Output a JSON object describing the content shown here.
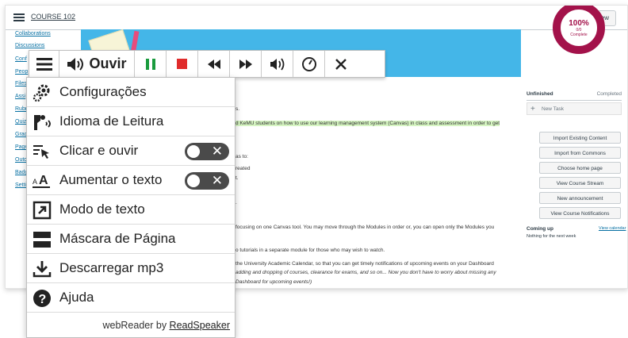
{
  "canvas": {
    "course_title": "COURSE 102",
    "student_view_label": "Student view",
    "nav_items": [
      "Collaborations",
      "Discussions",
      "Conf",
      "Peop",
      "Files",
      "Assi",
      "Rubr",
      "Quiz",
      "Grad",
      "Page",
      "Outc",
      "Badg",
      "Setti"
    ],
    "main_lines": [
      "s.",
      "d KeMU students on how to use our learning management system (Canvas) in class and assessment in order to get",
      "as to:",
      "reated",
      "t.",
      ".",
      "focusing on one Canvas tool. You may move through the Modules in order or, you can open only the Modules you",
      "o tutorials in a separate module for those who may wish to watch.",
      "the University Academic Calendar, so that you can get timely notifications of upcoming events on your Dashboard",
      "adding and dropping of courses, clearance for exams, and so on... Now you don't have to worry about missing any",
      "Dashboard for upcoming events!)"
    ],
    "progress": {
      "percent_label": "100%",
      "count_label": "0/0",
      "status_label": "Complete",
      "value": 1.0
    },
    "todo": {
      "unfinished": "Unfinished",
      "completed": "Completed",
      "new_task": "New Task"
    },
    "sidebar_buttons": [
      "Import Existing Content",
      "Import from Commons",
      "Choose home page",
      "View Course Stream",
      "New announcement",
      "View Course Notifications"
    ],
    "coming_up": "Coming up",
    "view_calendar": "View calendar",
    "nothing_next_week": "Nothing for the next week",
    "banner_color": "#44b6e8",
    "progress_color": "#a3124a"
  },
  "readspeaker": {
    "listen_label": "Ouvir",
    "toolbar_icons": [
      "menu-icon",
      "speaker-icon",
      "pause-icon",
      "stop-icon",
      "rewind-icon",
      "fast-forward-icon",
      "volume-icon",
      "speed-icon",
      "close-icon"
    ],
    "menu": [
      {
        "label": "Configurações",
        "icon": "settings-icon"
      },
      {
        "label": "Idioma de Leitura",
        "icon": "reading-language-icon"
      },
      {
        "label": "Clicar e ouvir",
        "icon": "click-listen-icon",
        "toggle": false
      },
      {
        "label": "Aumentar o texto",
        "icon": "enlarge-text-icon",
        "toggle": false
      },
      {
        "label": "Modo de texto",
        "icon": "text-mode-icon"
      },
      {
        "label": "Máscara de Página",
        "icon": "page-mask-icon"
      },
      {
        "label": "Descarregar mp3",
        "icon": "download-icon"
      },
      {
        "label": "Ajuda",
        "icon": "help-icon"
      }
    ],
    "footer_prefix": "webReader by ",
    "footer_link": "ReadSpeaker",
    "pause_color": "#1a9b3e",
    "stop_color": "#e02b2b"
  }
}
